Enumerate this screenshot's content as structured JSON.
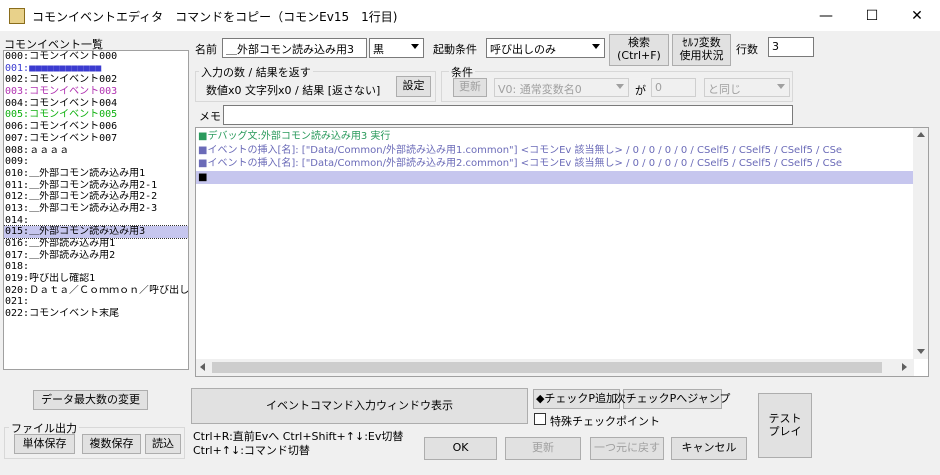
{
  "window": {
    "title": "コモンイベントエディタ　コマンドをコピー（コモンEv15　1行目)",
    "minimize": "—",
    "maximize": "☐",
    "close": "✕"
  },
  "common_list": {
    "label": "コモンイベント一覧",
    "items": [
      {
        "text": "000:コモンイベント000",
        "color": "#000000"
      },
      {
        "text": "001:■■■■■■■■■■■■",
        "color": "#3b3bd0"
      },
      {
        "text": "002:コモンイベント002",
        "color": "#000000"
      },
      {
        "text": "003:コモンイベント003",
        "color": "#b030b0"
      },
      {
        "text": "004:コモンイベント004",
        "color": "#000000"
      },
      {
        "text": "005:コモンイベント005",
        "color": "#10b010"
      },
      {
        "text": "006:コモンイベント006",
        "color": "#000000"
      },
      {
        "text": "007:コモンイベント007",
        "color": "#000000"
      },
      {
        "text": "008:ａａａａ",
        "color": "#000000"
      },
      {
        "text": "009:",
        "color": "#000000"
      },
      {
        "text": "010:＿外部コモン読み込み用1",
        "color": "#000000"
      },
      {
        "text": "011:＿外部コモン読み込み用2-1",
        "color": "#000000"
      },
      {
        "text": "012:＿外部コモン読み込み用2-2",
        "color": "#000000"
      },
      {
        "text": "013:＿外部コモン読み込み用2-3",
        "color": "#000000"
      },
      {
        "text": "014:",
        "color": "#000000"
      },
      {
        "text": "015:＿外部コモン読み込み用3",
        "color": "#000000"
      },
      {
        "text": "016:＿外部読み込み用1",
        "color": "#000000"
      },
      {
        "text": "017:＿外部読み込み用2",
        "color": "#000000"
      },
      {
        "text": "018:",
        "color": "#000000"
      },
      {
        "text": "019:呼び出し確認1",
        "color": "#000000"
      },
      {
        "text": "020:Ｄａｔａ／Ｃｏｍｍｏｎ／呼び出し確認",
        "color": "#000000"
      },
      {
        "text": "021:",
        "color": "#000000"
      },
      {
        "text": "022:コモンイベント末尾",
        "color": "#000000"
      }
    ],
    "selected_index": 15
  },
  "name_field": {
    "label": "名前",
    "value": "＿外部コモン読み込み用3"
  },
  "color_select": {
    "value": "黒"
  },
  "trigger": {
    "label": "起動条件",
    "value": "呼び出しのみ"
  },
  "search_button": {
    "line1": "検索",
    "line2": "(Ctrl+F)"
  },
  "self_var_button": {
    "line1": "ｾﾙﾌ変数",
    "line2": "使用状況"
  },
  "line_count": {
    "label": "行数",
    "value": "3"
  },
  "io_group": {
    "label": "入力の数 / 結果を返す",
    "summary": "数値x0 文字列x0 / 結果 [返さない]",
    "button": "設定"
  },
  "condition_group": {
    "label": "条件",
    "update": "更新",
    "variable": "V0: 通常変数名0",
    "ga": "が",
    "value": "0",
    "comparator": "と同じ"
  },
  "memo": {
    "label": "メモ",
    "value": ""
  },
  "editor_lines": [
    {
      "text": "■デバッグ文:外部コモン読み込み用3  実行",
      "color": "#2a9a5c"
    },
    {
      "text": "■イベントの挿入[名]: [\"Data/Common/外部読み込み用1.common\"] <コモンEv 該当無し>  / 0 / 0 / 0 / 0 / CSelf5 / CSelf5 / CSelf5 / CSe",
      "color": "#6b6bb8"
    },
    {
      "text": "■イベントの挿入[名]: [\"Data/Common/外部読み込み用2.common\"] <コモンEv 該当無し>  / 0 / 0 / 0 / 0 / CSelf5 / CSelf5 / CSelf5 / CSe",
      "color": "#6b6bb8"
    },
    {
      "text": "■",
      "color": "#000000"
    }
  ],
  "bottom": {
    "data_max_button": "データ最大数の変更",
    "file_output_label": "ファイル出力",
    "single_save": "単体保存",
    "multi_save": "複数保存",
    "load": "読込",
    "event_cmd_window": "イベントコマンド入力ウィンドウ表示",
    "help_line1": "Ctrl+R:直前Evへ  Ctrl+Shift+↑↓:Ev切替",
    "help_line2": "Ctrl+↑↓:コマンド切替",
    "check_add": "◆チェックP追加",
    "next_check": "次チェックPへジャンプ",
    "special_check": "特殊チェックポイント",
    "ok": "OK",
    "update": "更新",
    "undo": "一つ元に戻す",
    "cancel": "キャンセル",
    "test_line1": "テスト",
    "test_line2": "プレイ"
  }
}
